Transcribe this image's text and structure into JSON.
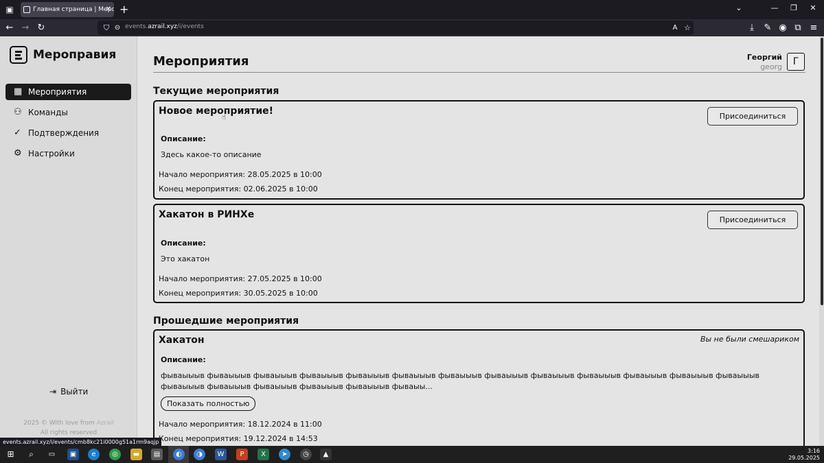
{
  "browser": {
    "tab_title": "Главная страница | Меропра",
    "url_prefix": "events.",
    "url_domain": "azrail.xyz",
    "url_path": "/i/events",
    "status_url": "events.azrail.xyz/i/events/cmb8kc21i0000g51a1rm9aqjp"
  },
  "sidebar": {
    "brand": "Мероправия",
    "items": [
      {
        "label": "Мероприятия",
        "icon": "calendar-icon"
      },
      {
        "label": "Команды",
        "icon": "users-icon"
      },
      {
        "label": "Подтверждения",
        "icon": "check-circle-icon"
      },
      {
        "label": "Настройки",
        "icon": "gear-icon"
      }
    ],
    "logout": "Выйти",
    "footer_line1_prefix": "2025 © With love from ",
    "footer_link": "Azrail",
    "footer_line2": "All rights reserved"
  },
  "header": {
    "title": "Мероприятия",
    "user_name": "Георгий",
    "user_login": "georg",
    "avatar_letter": "Г"
  },
  "current": {
    "title": "Текущие мероприятия",
    "events": [
      {
        "name": "Новое мероприятие!",
        "join_label": "Присоединиться",
        "desc_label": "Описание:",
        "desc": "Здесь какое-то описание",
        "start": "Начало мероприятия: 28.05.2025 в 10:00",
        "end": "Конец мероприятия: 02.06.2025 в 10:00"
      },
      {
        "name": "Хакатон в РИНХе",
        "join_label": "Присоединиться",
        "desc_label": "Описание:",
        "desc": "Это хакатон",
        "start": "Начало мероприятия: 27.05.2025 в 10:00",
        "end": "Конец мероприятия: 30.05.2025 в 10:00"
      }
    ]
  },
  "past": {
    "title": "Прошедшие мероприятия",
    "events": [
      {
        "name": "Хакатон",
        "status": "Вы не были смешариком",
        "desc_label": "Описание:",
        "desc": "фываыыыв фываыыыв фываыыыв фываыыыв фываыыыв фываыыыв фываыыыв фываыыыв фываыыыв фываыыыв фываыыыв фываыыыв фываыыыв фываыыыв фываыыыв фываыыыв фываыыыв фываыыыв фываыы...",
        "show_more": "Показать полностью",
        "start": "Начало мероприятия: 18.12.2024 в 11:00",
        "end": "Конец мероприятия: 19.12.2024 в 14:53"
      }
    ]
  },
  "taskbar": {
    "time": "3:16",
    "date": "29.05.2025"
  }
}
